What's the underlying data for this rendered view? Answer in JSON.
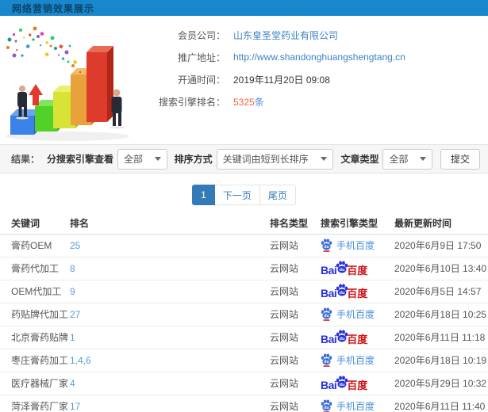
{
  "banner": {
    "title": "网络营销效果展示"
  },
  "profile": {
    "fields": [
      {
        "label": "会员公司：",
        "value": "山东皇圣堂药业有限公司",
        "type": "link"
      },
      {
        "label": "推广地址：",
        "value": "http://www.shandonghuangshengtang.cn",
        "type": "link"
      },
      {
        "label": "开通时间：",
        "value": "2019年11月20日 09:08",
        "type": "text"
      },
      {
        "label": "搜索引擎排名：",
        "value": "5325",
        "suffix": "条",
        "type": "highlight"
      }
    ]
  },
  "filters": {
    "result_label": "结果：",
    "engine_label": "分搜索引擎查看",
    "engine_value": "全部",
    "sort_label": "排序方式",
    "sort_value": "关键词由短到长排序",
    "article_label": "文章类型",
    "article_value": "全部",
    "submit_label": "提交"
  },
  "pagination": {
    "current": "1",
    "next": "下一页",
    "last": "尾页"
  },
  "engine_logo": {
    "bai": "Bai",
    "du": "du",
    "cn": "百度",
    "mobile_text": "手机百度"
  },
  "table": {
    "headers": [
      "关键词",
      "排名",
      "排名类型",
      "搜索引擎类型",
      "最新更新时间"
    ],
    "rows": [
      {
        "keyword": "膏药OEM",
        "rank": "25",
        "rank_type": "云网站",
        "engine": "mobile",
        "updated": "2020年6月9日 17:50"
      },
      {
        "keyword": "膏药代加工",
        "rank": "8",
        "rank_type": "云网站",
        "engine": "baidu",
        "updated": "2020年6月10日 13:40"
      },
      {
        "keyword": "OEM代加工",
        "rank": "9",
        "rank_type": "云网站",
        "engine": "baidu",
        "updated": "2020年6月5日 14:57"
      },
      {
        "keyword": "药贴牌代加工",
        "rank": "27",
        "rank_type": "云网站",
        "engine": "mobile",
        "updated": "2020年6月18日 10:25"
      },
      {
        "keyword": "北京膏药贴牌",
        "rank": "1",
        "rank_type": "云网站",
        "engine": "baidu",
        "updated": "2020年6月11日 11:18"
      },
      {
        "keyword": "枣庄膏药加工",
        "rank": "1,4,6",
        "rank_type": "云网站",
        "engine": "mobile",
        "updated": "2020年6月18日 10:19"
      },
      {
        "keyword": "医疗器械厂家",
        "rank": "4",
        "rank_type": "云网站",
        "engine": "baidu",
        "updated": "2020年5月29日 10:32"
      },
      {
        "keyword": "菏泽膏药厂家",
        "rank": "17",
        "rank_type": "云网站",
        "engine": "mobile",
        "updated": "2020年6月11日 11:40"
      }
    ]
  },
  "colors": {
    "banner_bg": "#1887cb",
    "banner_text": "#0d4468",
    "link": "#3e82c4",
    "highlight": "#f2673d",
    "rank_blue": "#5b9bd5",
    "active_page": "#337ab7",
    "baidu_blue": "#2832d8",
    "baidu_red": "#d20f13"
  }
}
